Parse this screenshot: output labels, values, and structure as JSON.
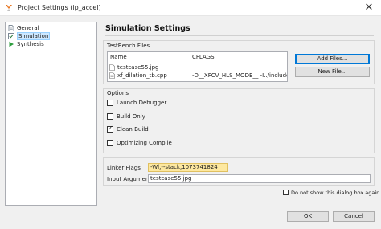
{
  "window": {
    "title": "Project Settings (ip_accel)",
    "close_glyph": "✕"
  },
  "nav": {
    "items": [
      {
        "label": "General",
        "icon": "document-icon"
      },
      {
        "label": "Simulation",
        "icon": "checkbox-icon",
        "selected": true
      },
      {
        "label": "Synthesis",
        "icon": "play-icon"
      }
    ]
  },
  "page": {
    "title": "Simulation Settings"
  },
  "testbench": {
    "group_label": "TestBench Files",
    "columns": [
      "Name",
      "CFLAGS"
    ],
    "rows": [
      {
        "name": "testcase55.jpg",
        "cflags": ""
      },
      {
        "name": "xf_dilation_tb.cpp",
        "cflags": "-D__XFCV_HLS_MODE__ -I../include -st..."
      }
    ],
    "add_files_label": "Add Files...",
    "new_file_label": "New File..."
  },
  "options": {
    "group_label": "Options",
    "items": [
      {
        "label": "Launch Debugger",
        "checked": false
      },
      {
        "label": "Build Only",
        "checked": false
      },
      {
        "label": "Clean Build",
        "checked": true
      },
      {
        "label": "Optimizing Compile",
        "checked": false
      }
    ]
  },
  "fields": {
    "linker_flags_label": "Linker Flags",
    "linker_flags_value": "-Wl,--stack,1073741824",
    "input_args_label": "Input Arguments",
    "input_args_value": "testcase55.jpg"
  },
  "footer": {
    "dont_show_label": "Do not show this dialog box again.",
    "dont_show_checked": false,
    "ok_label": "OK",
    "cancel_label": "Cancel"
  },
  "colors": {
    "accent": "#0078d7",
    "selection": "#cde8ff",
    "highlight_field": "#fde8a0",
    "play_icon": "#2e9e3e"
  }
}
